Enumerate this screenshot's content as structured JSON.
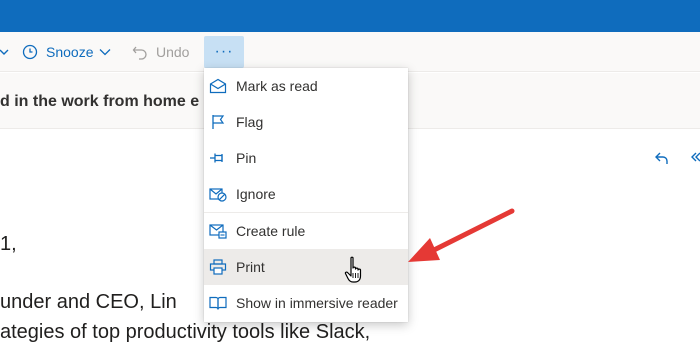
{
  "toolbar": {
    "snooze_label": "Snooze",
    "undo_label": "Undo",
    "more_label": "···"
  },
  "message": {
    "subject_fragment": "d in the work from home e",
    "body_lines": [
      "1,",
      "under and CEO, Lin",
      "ategies of top productivity tools like Slack,"
    ]
  },
  "menu": {
    "items": [
      {
        "label": "Mark as read",
        "icon": "envelope-open-icon"
      },
      {
        "label": "Flag",
        "icon": "flag-icon"
      },
      {
        "label": "Pin",
        "icon": "pin-icon"
      },
      {
        "label": "Ignore",
        "icon": "ignore-icon"
      },
      {
        "label": "Create rule",
        "icon": "rule-icon"
      },
      {
        "label": "Print",
        "icon": "printer-icon"
      },
      {
        "label": "Show in immersive reader",
        "icon": "immersive-reader-icon"
      }
    ],
    "hovered_item": "Print"
  },
  "colors": {
    "brand": "#0f6cbd",
    "annotation_arrow": "#e53935",
    "hover_bg": "#edebe9"
  }
}
